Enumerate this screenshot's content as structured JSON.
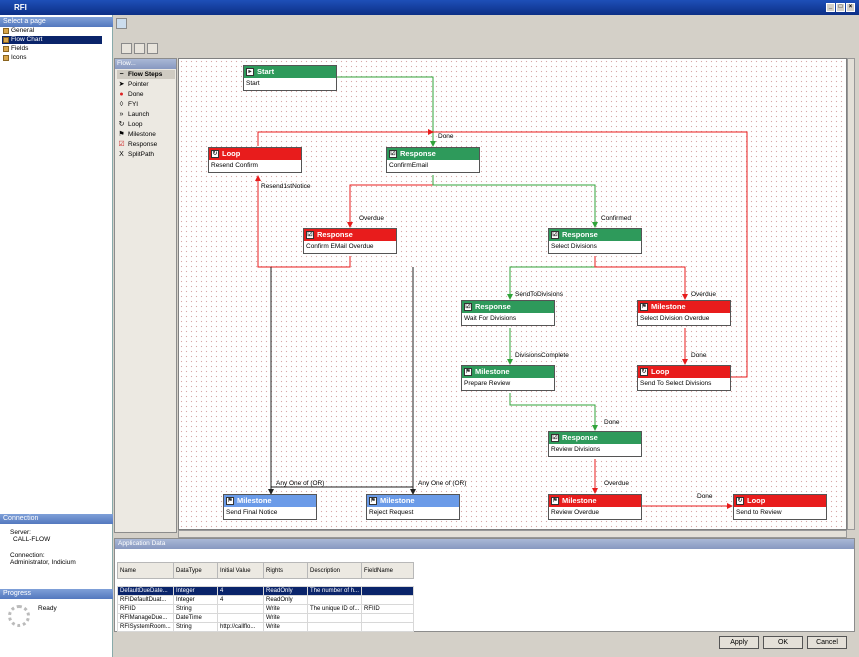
{
  "window": {
    "title": "RFI"
  },
  "sidebar": {
    "select_page_header": "Select a page",
    "pages": [
      {
        "label": "General"
      },
      {
        "label": "Flow Chart"
      },
      {
        "label": "Fields"
      },
      {
        "label": "Icons"
      }
    ],
    "selected_page": "Flow Chart",
    "connection_header": "Connection",
    "server_label": "Server:",
    "server_value": "CALL-FLOW",
    "connection_label": "Connection:",
    "connection_value": "Administrator, Indicium",
    "progress_header": "Progress",
    "progress_status": "Ready"
  },
  "toolbox": {
    "title": "Flow...",
    "items": [
      {
        "label": "Flow Steps",
        "icon": "steps-icon"
      },
      {
        "label": "Pointer",
        "icon": "pointer-icon"
      },
      {
        "label": "Done",
        "icon": "done-icon"
      },
      {
        "label": "FYI",
        "icon": "fyi-icon"
      },
      {
        "label": "Launch",
        "icon": "launch-icon"
      },
      {
        "label": "Loop",
        "icon": "loop-icon"
      },
      {
        "label": "Milestone",
        "icon": "milestone-icon"
      },
      {
        "label": "Response",
        "icon": "response-icon"
      },
      {
        "label": "SplitPath",
        "icon": "splitpath-icon"
      }
    ]
  },
  "nodes": [
    {
      "id": "start",
      "type": "Start",
      "name": "Start",
      "color": "#2e9a5b"
    },
    {
      "id": "loop1",
      "type": "Loop",
      "name": "Resend Confirm",
      "color": "#e81c1c"
    },
    {
      "id": "resp1",
      "type": "Response",
      "name": "ConfirmEmail",
      "color": "#2e9a5b"
    },
    {
      "id": "resp2",
      "type": "Response",
      "name": "Confirm EMail Overdue",
      "color": "#e81c1c"
    },
    {
      "id": "resp3",
      "type": "Response",
      "name": "Select Divisions",
      "color": "#2e9a5b"
    },
    {
      "id": "resp4",
      "type": "Response",
      "name": "Wait For Divisions",
      "color": "#2e9a5b"
    },
    {
      "id": "ms1",
      "type": "Milestone",
      "name": "Select Division Overdue",
      "color": "#e81c1c"
    },
    {
      "id": "ms2",
      "type": "Milestone",
      "name": "Prepare Review",
      "color": "#2e9a5b"
    },
    {
      "id": "loop2",
      "type": "Loop",
      "name": "Send To Select Divisions",
      "color": "#e81c1c"
    },
    {
      "id": "resp5",
      "type": "Response",
      "name": "Review Divisions",
      "color": "#2e9a5b"
    },
    {
      "id": "ms3",
      "type": "Milestone",
      "name": "Send Final Notice",
      "color": "#6b9be8"
    },
    {
      "id": "ms4",
      "type": "Milestone",
      "name": "Reject Request",
      "color": "#6b9be8"
    },
    {
      "id": "ms5",
      "type": "Milestone",
      "name": "Review Overdue",
      "color": "#e81c1c"
    },
    {
      "id": "loop3",
      "type": "Loop",
      "name": "Send to Review",
      "color": "#e81c1c"
    }
  ],
  "edge_labels": [
    "Done",
    "Resend1stNotice",
    "Overdue",
    "Confirmed",
    "SendToDivisions",
    "Overdue",
    "DivisionsComplete",
    "Done",
    "Done",
    "Any One of (OR)",
    "Any One of (OR)",
    "Overdue",
    "Done"
  ],
  "app_data": {
    "title": "Application Data",
    "columns": [
      "Name",
      "DataType",
      "Initial Value",
      "Rights",
      "Description",
      "FieldName"
    ],
    "rows": [
      [
        "DefaultDueDate...",
        "Integer",
        "4",
        "ReadOnly",
        "The number of h...",
        ""
      ],
      [
        "RFIDefaultDuat...",
        "Integer",
        "4",
        "ReadOnly",
        "",
        ""
      ],
      [
        "RFIID",
        "String",
        "",
        "Write",
        "The unique ID of...",
        "RFIID"
      ],
      [
        "RFIManageDue...",
        "DateTime",
        "",
        "Write",
        "",
        ""
      ],
      [
        "RFISystemRoom...",
        "String",
        "http://callflo...",
        "Write",
        "",
        ""
      ]
    ]
  },
  "buttons": {
    "apply": "Apply",
    "ok": "OK",
    "cancel": "Cancel"
  }
}
